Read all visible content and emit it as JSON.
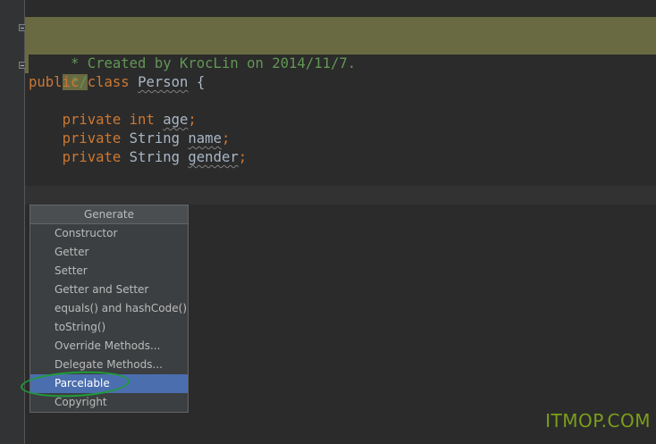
{
  "editor": {
    "doc_open": "/**",
    "doc_body": " * Created by KrocLin on 2014/11/7.",
    "doc_close": " */",
    "class_kw1": "public",
    "class_kw2": "class",
    "class_name": "Person",
    "class_brace": "{",
    "fields": [
      {
        "mod": "private",
        "type": "int",
        "name": "age",
        "semi": ";"
      },
      {
        "mod": "private",
        "type": "String",
        "name": "name",
        "semi": ";"
      },
      {
        "mod": "private",
        "type": "String",
        "name": "gender",
        "semi": ";"
      }
    ]
  },
  "generate_menu": {
    "title": "Generate",
    "items": [
      "Constructor",
      "Getter",
      "Setter",
      "Getter and Setter",
      "equals() and hashCode()",
      "toString()",
      "Override Methods...",
      "Delegate Methods...",
      "Parcelable",
      "Copyright"
    ],
    "selected": "Parcelable"
  },
  "watermark": "ITMOP.COM",
  "colors": {
    "background": "#2b2b2b",
    "keyword": "#cc7832",
    "doc_comment": "#629755",
    "selection": "#4b6eaf",
    "annotation_circle": "#1f9d3a"
  }
}
